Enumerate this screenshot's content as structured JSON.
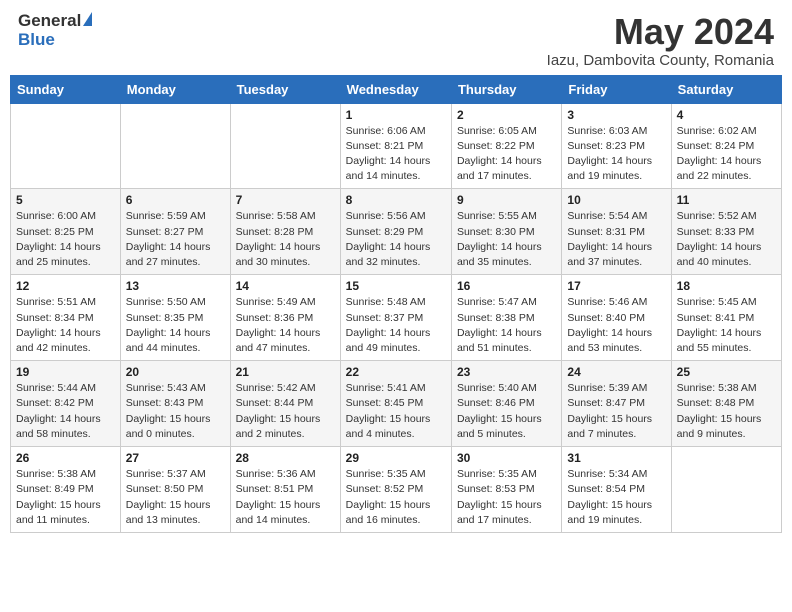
{
  "logo": {
    "general": "General",
    "blue": "Blue"
  },
  "title": "May 2024",
  "location": "Iazu, Dambovita County, Romania",
  "days_of_week": [
    "Sunday",
    "Monday",
    "Tuesday",
    "Wednesday",
    "Thursday",
    "Friday",
    "Saturday"
  ],
  "weeks": [
    [
      {
        "day": "",
        "info": ""
      },
      {
        "day": "",
        "info": ""
      },
      {
        "day": "",
        "info": ""
      },
      {
        "day": "1",
        "info": "Sunrise: 6:06 AM\nSunset: 8:21 PM\nDaylight: 14 hours and 14 minutes."
      },
      {
        "day": "2",
        "info": "Sunrise: 6:05 AM\nSunset: 8:22 PM\nDaylight: 14 hours and 17 minutes."
      },
      {
        "day": "3",
        "info": "Sunrise: 6:03 AM\nSunset: 8:23 PM\nDaylight: 14 hours and 19 minutes."
      },
      {
        "day": "4",
        "info": "Sunrise: 6:02 AM\nSunset: 8:24 PM\nDaylight: 14 hours and 22 minutes."
      }
    ],
    [
      {
        "day": "5",
        "info": "Sunrise: 6:00 AM\nSunset: 8:25 PM\nDaylight: 14 hours and 25 minutes."
      },
      {
        "day": "6",
        "info": "Sunrise: 5:59 AM\nSunset: 8:27 PM\nDaylight: 14 hours and 27 minutes."
      },
      {
        "day": "7",
        "info": "Sunrise: 5:58 AM\nSunset: 8:28 PM\nDaylight: 14 hours and 30 minutes."
      },
      {
        "day": "8",
        "info": "Sunrise: 5:56 AM\nSunset: 8:29 PM\nDaylight: 14 hours and 32 minutes."
      },
      {
        "day": "9",
        "info": "Sunrise: 5:55 AM\nSunset: 8:30 PM\nDaylight: 14 hours and 35 minutes."
      },
      {
        "day": "10",
        "info": "Sunrise: 5:54 AM\nSunset: 8:31 PM\nDaylight: 14 hours and 37 minutes."
      },
      {
        "day": "11",
        "info": "Sunrise: 5:52 AM\nSunset: 8:33 PM\nDaylight: 14 hours and 40 minutes."
      }
    ],
    [
      {
        "day": "12",
        "info": "Sunrise: 5:51 AM\nSunset: 8:34 PM\nDaylight: 14 hours and 42 minutes."
      },
      {
        "day": "13",
        "info": "Sunrise: 5:50 AM\nSunset: 8:35 PM\nDaylight: 14 hours and 44 minutes."
      },
      {
        "day": "14",
        "info": "Sunrise: 5:49 AM\nSunset: 8:36 PM\nDaylight: 14 hours and 47 minutes."
      },
      {
        "day": "15",
        "info": "Sunrise: 5:48 AM\nSunset: 8:37 PM\nDaylight: 14 hours and 49 minutes."
      },
      {
        "day": "16",
        "info": "Sunrise: 5:47 AM\nSunset: 8:38 PM\nDaylight: 14 hours and 51 minutes."
      },
      {
        "day": "17",
        "info": "Sunrise: 5:46 AM\nSunset: 8:40 PM\nDaylight: 14 hours and 53 minutes."
      },
      {
        "day": "18",
        "info": "Sunrise: 5:45 AM\nSunset: 8:41 PM\nDaylight: 14 hours and 55 minutes."
      }
    ],
    [
      {
        "day": "19",
        "info": "Sunrise: 5:44 AM\nSunset: 8:42 PM\nDaylight: 14 hours and 58 minutes."
      },
      {
        "day": "20",
        "info": "Sunrise: 5:43 AM\nSunset: 8:43 PM\nDaylight: 15 hours and 0 minutes."
      },
      {
        "day": "21",
        "info": "Sunrise: 5:42 AM\nSunset: 8:44 PM\nDaylight: 15 hours and 2 minutes."
      },
      {
        "day": "22",
        "info": "Sunrise: 5:41 AM\nSunset: 8:45 PM\nDaylight: 15 hours and 4 minutes."
      },
      {
        "day": "23",
        "info": "Sunrise: 5:40 AM\nSunset: 8:46 PM\nDaylight: 15 hours and 5 minutes."
      },
      {
        "day": "24",
        "info": "Sunrise: 5:39 AM\nSunset: 8:47 PM\nDaylight: 15 hours and 7 minutes."
      },
      {
        "day": "25",
        "info": "Sunrise: 5:38 AM\nSunset: 8:48 PM\nDaylight: 15 hours and 9 minutes."
      }
    ],
    [
      {
        "day": "26",
        "info": "Sunrise: 5:38 AM\nSunset: 8:49 PM\nDaylight: 15 hours and 11 minutes."
      },
      {
        "day": "27",
        "info": "Sunrise: 5:37 AM\nSunset: 8:50 PM\nDaylight: 15 hours and 13 minutes."
      },
      {
        "day": "28",
        "info": "Sunrise: 5:36 AM\nSunset: 8:51 PM\nDaylight: 15 hours and 14 minutes."
      },
      {
        "day": "29",
        "info": "Sunrise: 5:35 AM\nSunset: 8:52 PM\nDaylight: 15 hours and 16 minutes."
      },
      {
        "day": "30",
        "info": "Sunrise: 5:35 AM\nSunset: 8:53 PM\nDaylight: 15 hours and 17 minutes."
      },
      {
        "day": "31",
        "info": "Sunrise: 5:34 AM\nSunset: 8:54 PM\nDaylight: 15 hours and 19 minutes."
      },
      {
        "day": "",
        "info": ""
      }
    ]
  ]
}
